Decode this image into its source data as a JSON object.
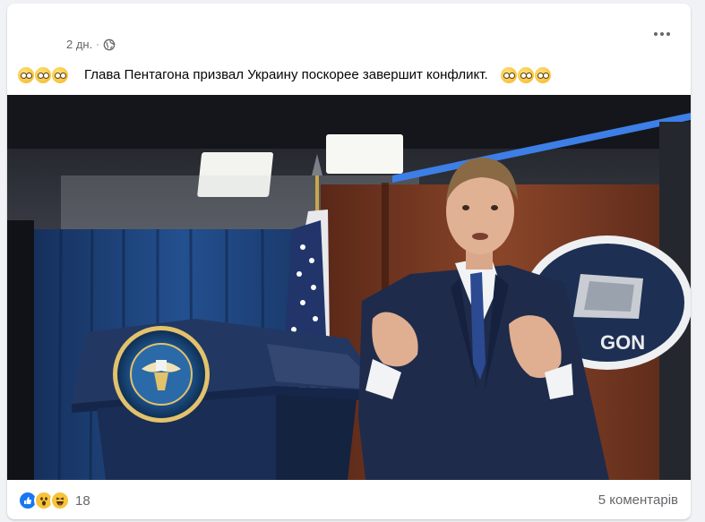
{
  "post": {
    "time": "2 дн.",
    "separator": "·",
    "caption": "Глава Пентагона призвал Украину поскорее завершит конфликт.",
    "caption_emoji": "clown-face-emoji",
    "privacy_icon": "globe-icon",
    "menu_icon": "more-options-icon"
  },
  "photo": {
    "seal_text": "DEPARTMENT OF DEFENSE · UNITED STATES OF AMERICA",
    "wall_sign": "GON"
  },
  "footer": {
    "reaction_icons": [
      "like-icon",
      "wow-icon",
      "haha-icon"
    ],
    "reaction_count": "18",
    "comments": "5 коментарів"
  },
  "colors": {
    "facebook_blue": "#1877f2",
    "secondary_text": "#65676b",
    "curtain_blue": "#1c3f78",
    "suit_navy": "#1f2b4a",
    "wood": "#7a3b25"
  }
}
